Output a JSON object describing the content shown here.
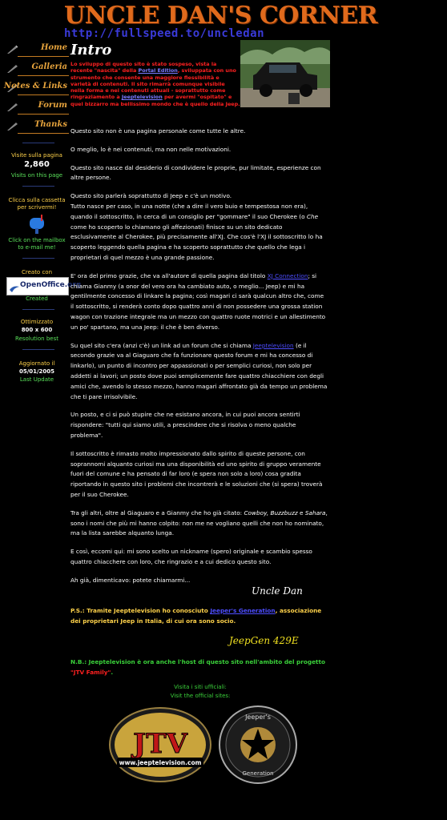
{
  "header": {
    "title": "UNCLE DAN'S CORNER",
    "url": "http://fullspeed.to/uncledan"
  },
  "sidebar": {
    "nav": [
      {
        "label": "Home",
        "icon": "pen-icon"
      },
      {
        "label": "Galleria",
        "icon": "pen-icon"
      },
      {
        "label": "Notes & Links",
        "icon": "pen-icon"
      },
      {
        "label": "Forum",
        "icon": "pen-icon"
      },
      {
        "label": "Thanks",
        "icon": "pen-icon"
      }
    ],
    "visits_label": "Visite sulla pagina",
    "visits_count": "2,860",
    "visits_en": "Visits on this page",
    "mail_it_1": "Clicca sulla cassetta",
    "mail_it_2": "per scrivermi!",
    "mail_en_1": "Click on the mailbox",
    "mail_en_2": "to e-mail me!",
    "created_with": "Creato con",
    "openoffice_brand": "OpenOffice.org",
    "created": "Created",
    "optimized": "Ottimizzato",
    "resolution": "800 x 600",
    "resolution_best": "Resolution best",
    "updated_label": "Aggiornato il",
    "updated_date": "05/01/2005",
    "last_update": "Last Update"
  },
  "intro": {
    "title": "Intro",
    "text_1": "Lo sviluppo di questo sito è stato sospeso, vista la recente \"nascita\" della",
    "link_1": "Portal Edition",
    "text_2": ", sviluppata con uno strumento che consente una maggiore flessibilità e varietà di contenuti. Il sito rimarrà comunque visibile nella forma e nei contenuti attuali - soprattutto come ringraziamento a",
    "link_2": "Jeeptelevision",
    "text_3": "per avermi \"ospitato\" e quel bizzarro ma bellissimo mondo che è quello della Jeep."
  },
  "content": {
    "p1": "Questo sito non è una pagina personale come tutte le altre.",
    "p2": "O meglio, lo è nei contenuti, ma non nelle motivazioni.",
    "p3": "Questo sito nasce dal desiderio di condividere le proprie, pur limitate, esperienze con altre persone.",
    "p4a": "Questo sito parlerà soprattutto di Jeep e c'è un motivo.",
    "p4b": "Tutto nasce per caso, in una notte (che a dire il vero buio e tempestosa non era), quando il sottoscritto, in cerca di un consiglio per \"gommare\" il suo Cherokee (o",
    "p4c": "Che",
    "p4d": "come ho scoperto lo chiamano gli affezionati) finisce su un sito dedicato esclusivamente al Cherokee, più precisamente all'XJ. Che cos'è l'XJ il sottoscritto lo ha scoperto leggendo quella pagina e ha scoperto soprattutto che quello che lega i proprietari di quel mezzo è una grande passione.",
    "p5a": "E' ora del primo grazie, che va all'autore di quella pagina dal titolo",
    "p5link": "XJ Connection",
    "p5b": "; si chiama Gianmy (a onor del vero ora ha cambiato auto, o meglio... Jeep) e mi ha gentilmente concesso di linkare la pagina; così magari ci sarà qualcun altro che, come il sottoscritto, si renderà conto dopo quattro anni di non possedere una grossa station wagon con trazione integrale ma un mezzo con quattro ruote motrici e un allestimento un po' spartano, ma una Jeep: il che è ben diverso.",
    "p6a": "Su quel sito c'era (anzi c'è) un link ad un forum che si chiama",
    "p6link": "Jeeptelevision",
    "p6b": "(e il secondo grazie va al Giaguaro che fa funzionare questo forum e mi ha concesso di linkarlo), un punto di incontro per appassionati o per semplici curiosi, non solo per addetti ai lavori; un posto dove puoi semplicemente fare quattro chiacchiere con degli amici che, avendo lo stesso mezzo, hanno magari affrontato già da tempo un problema che ti pare irrisolvibile.",
    "p7": "Un posto, e ci si può stupire che ne esistano ancora, in cui puoi ancora sentirti rispondere: \"tutti qui siamo utili, a prescindere che si risolva o meno qualche problema\".",
    "p8": "Il sottoscritto è rimasto molto impressionato dallo spirito di queste persone, con soprannomi alquanto curiosi ma una disponibilità ed uno spirito di gruppo veramente fuori del comune e ha pensato di far loro (e spera non solo a loro) cosa gradita riportando in questo sito i problemi che incontrerà e le soluzioni che (si spera) troverà per il suo Cherokee.",
    "p9a": "Tra gli altri, oltre al Giaguaro e a Gianmy che ho già citato:",
    "p9names1": "Cowboy, Buzzbuzz",
    "p9mid": "e",
    "p9names2": "Sahara",
    "p9b": ", sono i nomi che più mi hanno colpito: non me ne vogliano quelli che non ho nominato, ma la lista sarebbe alquanto lunga.",
    "p10": "E così, eccomi qui: mi sono scelto un nickname (spero) originale e scambio spesso quattro chiacchere con loro, che ringrazio e a cui dedico questo sito.",
    "p11": "Ah già, dimenticavo: potete chiamarmi..."
  },
  "signature": "Uncle Dan",
  "ps": {
    "prefix": "P.S.: Tramite Jeeptelevision ho conosciuto",
    "link": "Jeeper's Generation",
    "suffix": ", associazione dei proprietari Jeep in Italia, di cui ora sono socio."
  },
  "signature_2": "JeepGen 429E",
  "nb": {
    "text": "N.B.: Jeeptelevision è ora anche l'host di questo sito nell'ambito del progetto",
    "family": "\"JTV Family\"",
    "end": "."
  },
  "visit": {
    "it": "Visita i siti ufficiali:",
    "en": "Visit the official sites:"
  },
  "logos": {
    "jtv_letters": "JTV",
    "jtv_url": "www.jeeptelevision.com",
    "jeepers_top": "Jeeper's",
    "jeepers_bottom": "Generation"
  },
  "colors": {
    "title": "#e06a1c",
    "url": "#3a3ad8",
    "intro_red": "#ff2020",
    "ps_yellow": "#ffd24a",
    "nb_green": "#3ad13a",
    "link_blue": "#4d4dff"
  }
}
